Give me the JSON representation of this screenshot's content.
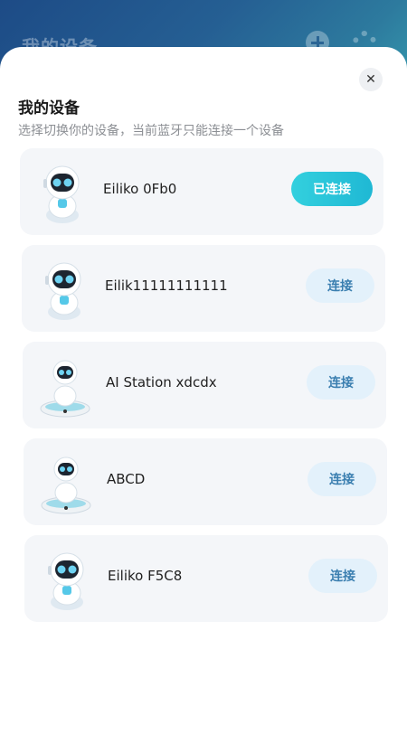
{
  "background": {
    "title": "我的设备",
    "add_icon": "plus-icon",
    "settings_icon": "gear-icon"
  },
  "sheet": {
    "title": "我的设备",
    "subtitle": "选择切换你的设备，当前蓝牙只能连接一个设备",
    "close_icon": "close-icon",
    "close_glyph": "✕"
  },
  "devices": [
    {
      "name": "Eiliko 0Fb0",
      "button": "已连接",
      "status": "connected",
      "icon": "robot-icon"
    },
    {
      "name": "Eilik11111111111",
      "button": "连接",
      "status": "disconnected",
      "icon": "robot-icon"
    },
    {
      "name": "AI Station xdcdx",
      "button": "连接",
      "status": "disconnected",
      "icon": "robot-station-icon"
    },
    {
      "name": "ABCD",
      "button": "连接",
      "status": "disconnected",
      "icon": "robot-station-icon"
    },
    {
      "name": "Eiliko F5C8",
      "button": "连接",
      "status": "disconnected",
      "icon": "robot-icon"
    }
  ],
  "colors": {
    "accent": "#1fb8d4",
    "connect_bg": "#e3f1fb",
    "connect_text": "#3b7fb0"
  }
}
